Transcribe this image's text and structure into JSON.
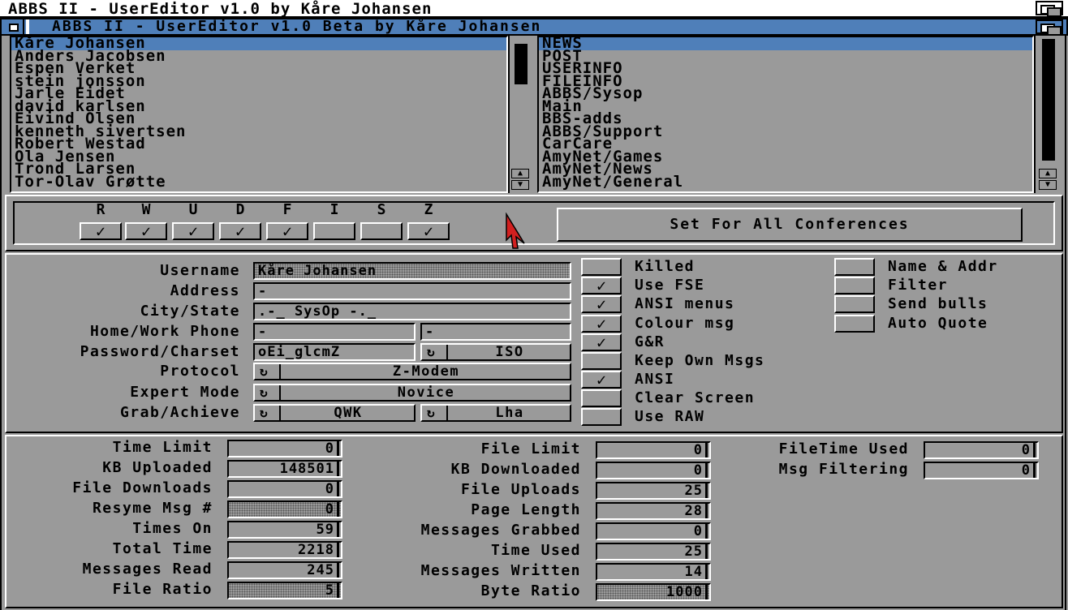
{
  "screen_title": "ABBS II - UserEditor v1.0 by Kåre Johansen",
  "window_title": "ABBS II - UserEditor v1.0 Beta by Kåre Johansen",
  "users": [
    "Kåre Johansen",
    "Anders Jacobsen",
    "Espen Verket",
    "stein jonsson",
    "Jarle Eidet",
    "david karlsen",
    "Eivind Olsen",
    "kenneth sivertsen",
    "Robert Westad",
    "Ola Jensen",
    "Trond Larsen",
    "Tor-Olav Grøtte"
  ],
  "conferences": [
    "NEWS",
    "POST",
    "USERINFO",
    "FILEINFO",
    "ABBS/Sysop",
    "Main",
    "BBS-adds",
    "ABBS/Support",
    "CarCare",
    "AmyNet/Games",
    "AmyNet/News",
    "AmyNet/General"
  ],
  "flags": {
    "labels": [
      "R",
      "W",
      "U",
      "D",
      "F",
      "I",
      "S",
      "Z"
    ],
    "checked": [
      true,
      true,
      true,
      true,
      true,
      false,
      false,
      true
    ],
    "check_mark": "✓"
  },
  "set_all_button": "Set For All Conferences",
  "user_fields": {
    "username_label": "Username",
    "username": "Kåre Johansen",
    "address_label": "Address",
    "address": "-",
    "city_label": "City/State",
    "city": ".-_ SysOp -._",
    "phone_label": "Home/Work Phone",
    "home_phone": "-",
    "work_phone": "-",
    "password_label": "Password/Charset",
    "password": "oEi_glcmZ",
    "charset": "ISO",
    "protocol_label": "Protocol",
    "protocol": "Z-Modem",
    "expert_label": "Expert Mode",
    "expert": "Novice",
    "grab_label": "Grab/Achieve",
    "grab": "QWK",
    "achieve": "Lha"
  },
  "options_mid": [
    {
      "label": "Killed",
      "checked": false
    },
    {
      "label": "Use FSE",
      "checked": true
    },
    {
      "label": "ANSI menus",
      "checked": true
    },
    {
      "label": "Colour msg",
      "checked": true
    },
    {
      "label": "G&R",
      "checked": true
    },
    {
      "label": "Keep Own Msgs",
      "checked": false
    },
    {
      "label": "ANSI",
      "checked": true
    },
    {
      "label": "Clear Screen",
      "checked": false
    },
    {
      "label": "Use RAW",
      "checked": false
    }
  ],
  "options_right": [
    {
      "label": "Name & Addr",
      "checked": false
    },
    {
      "label": "Filter",
      "checked": false
    },
    {
      "label": "Send bulls",
      "checked": false
    },
    {
      "label": "Auto Quote",
      "checked": false
    }
  ],
  "stats_left": [
    {
      "label": "Time Limit",
      "value": "0"
    },
    {
      "label": "KB Uploaded",
      "value": "148501"
    },
    {
      "label": "File Downloads",
      "value": "0"
    },
    {
      "label": "Resyme Msg #",
      "value": "0"
    },
    {
      "label": "Times On",
      "value": "59"
    },
    {
      "label": "Total Time",
      "value": "2218"
    },
    {
      "label": "Messages Read",
      "value": "245"
    },
    {
      "label": "File Ratio",
      "value": "5"
    }
  ],
  "stats_mid": [
    {
      "label": "File Limit",
      "value": "0"
    },
    {
      "label": "KB Downloaded",
      "value": "0"
    },
    {
      "label": "File Uploads",
      "value": "25"
    },
    {
      "label": "Page Length",
      "value": "28"
    },
    {
      "label": "Messages Grabbed",
      "value": "0"
    },
    {
      "label": "Time Used",
      "value": "25"
    },
    {
      "label": "Messages Written",
      "value": "14"
    },
    {
      "label": "Byte Ratio",
      "value": "1000"
    }
  ],
  "stats_right": [
    {
      "label": "FileTime Used",
      "value": "0"
    },
    {
      "label": "Msg Filtering",
      "value": "0"
    }
  ],
  "colors": {
    "background": "#9a9a9a",
    "accent": "#4f7fb9",
    "pointer": "#d22020"
  }
}
